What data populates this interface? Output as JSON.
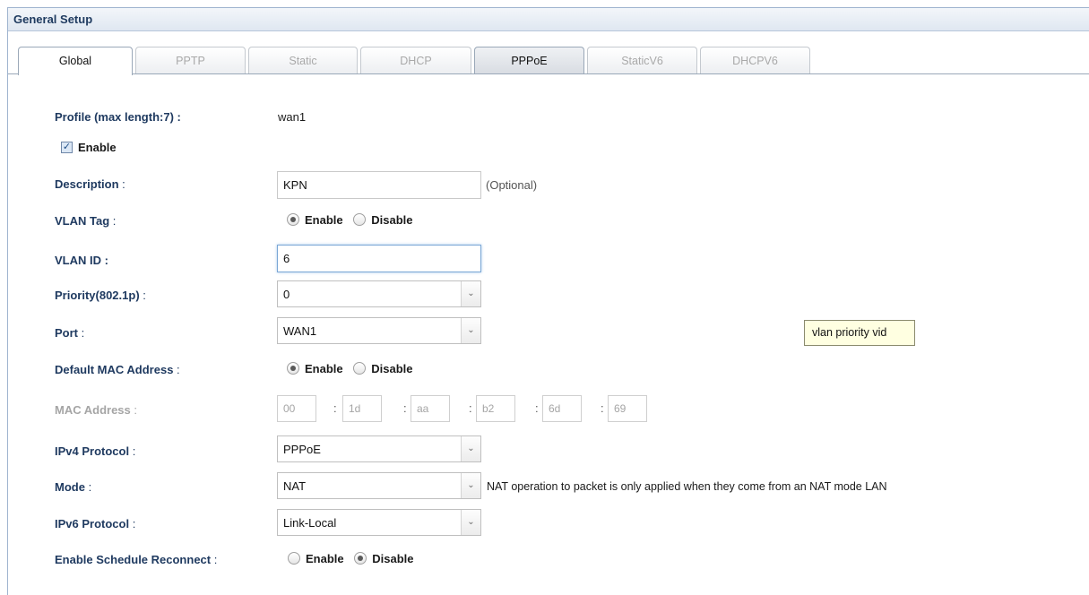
{
  "header": {
    "title": "General Setup"
  },
  "tabs": [
    {
      "label": "Global"
    },
    {
      "label": "PPTP"
    },
    {
      "label": "Static"
    },
    {
      "label": "DHCP"
    },
    {
      "label": "PPPoE"
    },
    {
      "label": "StaticV6"
    },
    {
      "label": "DHCPV6"
    }
  ],
  "form": {
    "profile": {
      "label": "Profile (max length:7) :",
      "value": "wan1"
    },
    "enable": {
      "label": "Enable",
      "checked": true,
      "check_glyph": "✓"
    },
    "description": {
      "label": "Description",
      "colon": " :",
      "value": "KPN",
      "hint": "(Optional)"
    },
    "vlan_tag": {
      "label": "VLAN Tag",
      "colon": " :",
      "opt_enable": "Enable",
      "opt_disable": "Disable",
      "selected": "Enable"
    },
    "vlan_id": {
      "label": "VLAN ID :",
      "value": "6"
    },
    "priority": {
      "label": "Priority(802.1p)",
      "colon": " :",
      "value": "0"
    },
    "port": {
      "label": "Port",
      "colon": " :",
      "value": "WAN1"
    },
    "default_mac": {
      "label": "Default MAC Address",
      "colon": " :",
      "opt_enable": "Enable",
      "opt_disable": "Disable",
      "selected": "Enable"
    },
    "mac_address": {
      "label": "MAC Address",
      "colon": " :",
      "octets": [
        "00",
        "1d",
        "aa",
        "b2",
        "6d",
        "69"
      ],
      "separator": ":"
    },
    "ipv4_protocol": {
      "label": "IPv4 Protocol",
      "colon": " :",
      "value": "PPPoE"
    },
    "mode": {
      "label": "Mode",
      "colon": " :",
      "value": "NAT",
      "note": "NAT operation to packet is only applied when they come from an NAT mode LAN"
    },
    "ipv6_protocol": {
      "label": "IPv6 Protocol",
      "colon": " :",
      "value": "Link-Local"
    },
    "schedule_reconnect": {
      "label": "Enable Schedule Reconnect",
      "colon": " :",
      "opt_enable": "Enable",
      "opt_disable": "Disable",
      "selected": "Disable"
    }
  },
  "tooltip": {
    "text": "vlan priority vid"
  },
  "glyphs": {
    "dropdown_arrow": "⌄"
  }
}
